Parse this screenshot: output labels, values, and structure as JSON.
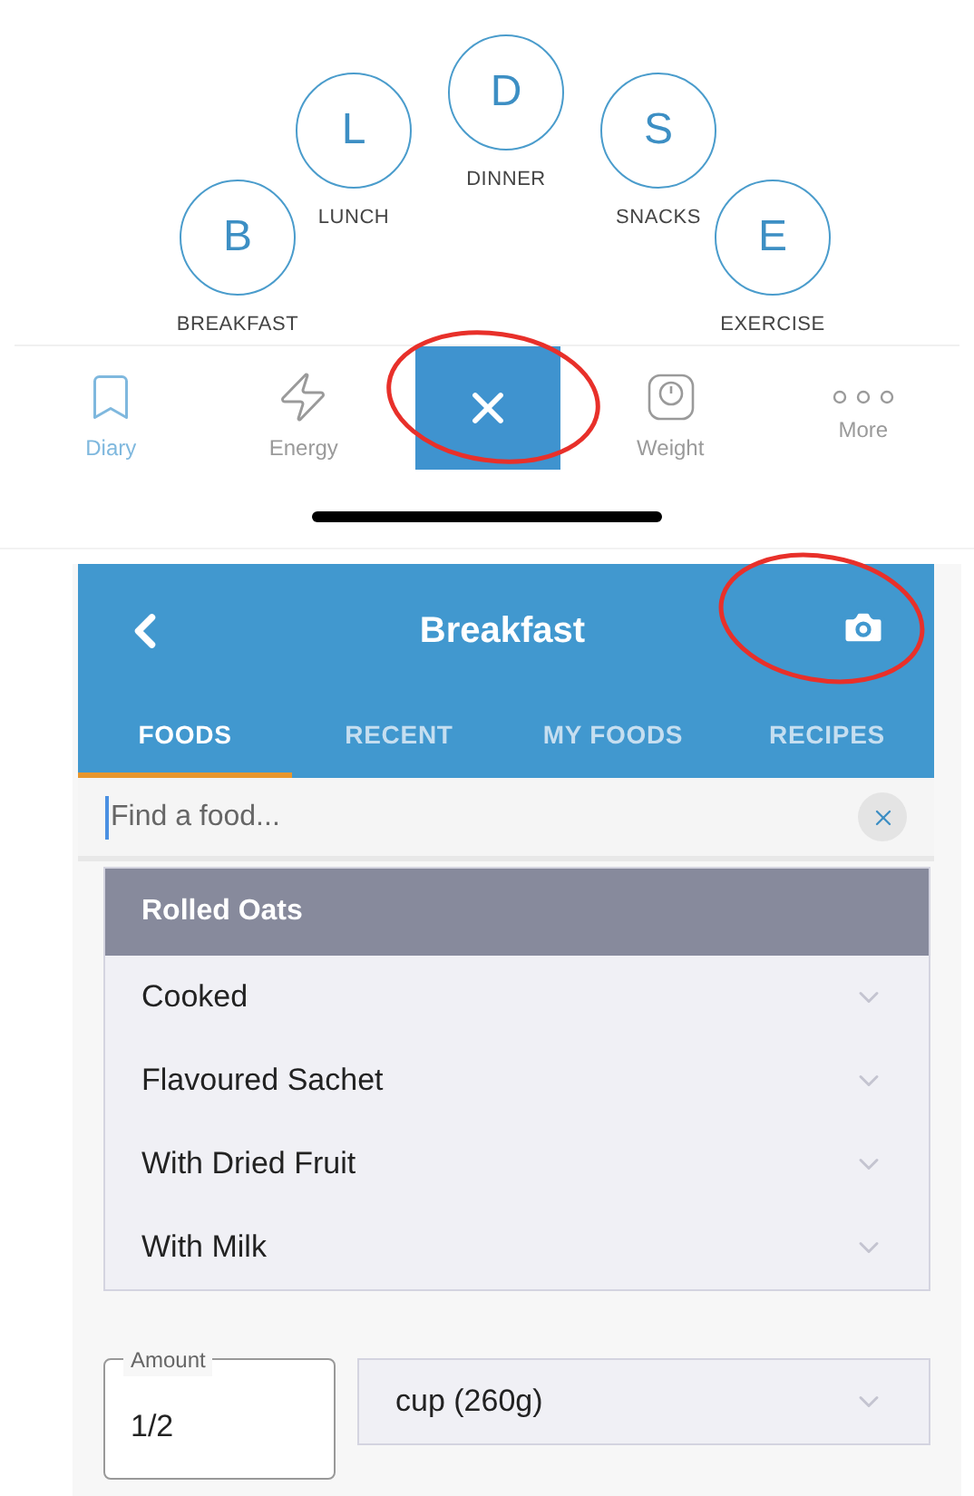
{
  "meal_shortcuts": [
    {
      "letter": "B",
      "label": "BREAKFAST"
    },
    {
      "letter": "L",
      "label": "LUNCH"
    },
    {
      "letter": "D",
      "label": "DINNER"
    },
    {
      "letter": "S",
      "label": "SNACKS"
    },
    {
      "letter": "E",
      "label": "EXERCISE"
    }
  ],
  "bottom_nav": {
    "items": [
      {
        "kind": "diary",
        "label": "Diary",
        "selected": true
      },
      {
        "kind": "energy",
        "label": "Energy",
        "selected": false
      },
      {
        "kind": "close",
        "circled": true
      },
      {
        "kind": "weight",
        "label": "Weight",
        "selected": false
      },
      {
        "kind": "more",
        "label": "More",
        "selected": false
      }
    ]
  },
  "food_screen": {
    "title": "Breakfast",
    "camera": {
      "circled": true
    },
    "tabs": [
      {
        "label": "FOODS",
        "selected": true
      },
      {
        "label": "RECENT",
        "selected": false
      },
      {
        "label": "MY FOODS",
        "selected": false
      },
      {
        "label": "RECIPES",
        "selected": false
      }
    ],
    "search": {
      "placeholder": "Find a food..."
    },
    "food_group": {
      "title": "Rolled Oats",
      "options": [
        "Cooked",
        "Flavoured Sachet",
        "With Dried Fruit",
        "With Milk"
      ]
    },
    "amount": {
      "label": "Amount",
      "value": "1/2"
    },
    "unit": {
      "value": "cup (260g)"
    }
  }
}
